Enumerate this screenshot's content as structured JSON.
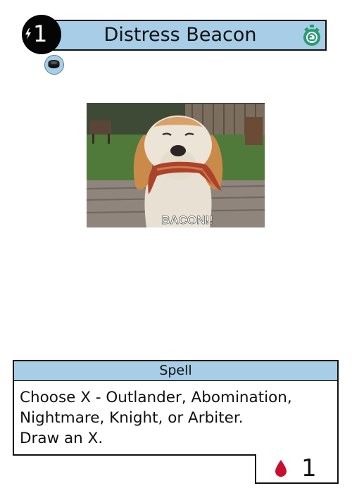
{
  "card": {
    "title": "Distress Beacon",
    "cost": "1",
    "type_line": "Spell",
    "rules_text": [
      "Choose X - Outlander, Abomination,",
      "Nightmare, Knight, or Arbiter.",
      "Draw an X."
    ],
    "stat_value": "1",
    "art_caption": "BACON!!",
    "icons": {
      "cost": "lightning-bolt-icon",
      "speed": "stopwatch-icon",
      "subtype": "disc-icon",
      "stat": "blood-drop-icon"
    },
    "colors": {
      "bar": "#a8cde6",
      "speed_icon": "#2a9a72",
      "blood": "#c8102e"
    }
  }
}
